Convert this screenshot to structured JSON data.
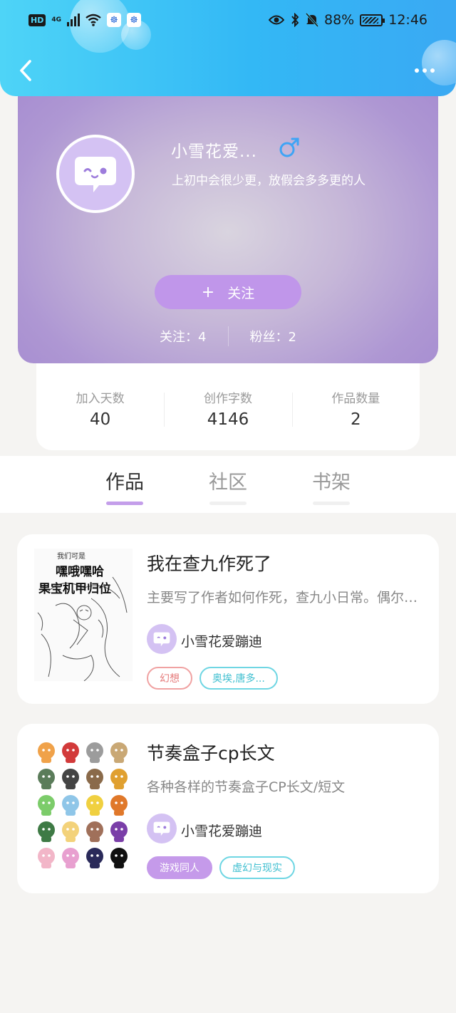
{
  "status_bar": {
    "network": "HD",
    "signal": "4G",
    "battery": "88%",
    "time": "12:46"
  },
  "profile": {
    "username": "小雪花爱...",
    "bio": "上初中会很少更，放假会多多更的人",
    "follow_button": "关注",
    "following": "关注：4",
    "followers": "粉丝：2"
  },
  "stats": [
    {
      "label": "加入天数",
      "value": "40"
    },
    {
      "label": "创作字数",
      "value": "4146"
    },
    {
      "label": "作品数量",
      "value": "2"
    }
  ],
  "tabs": [
    {
      "label": "作品",
      "active": true
    },
    {
      "label": "社区",
      "active": false
    },
    {
      "label": "书架",
      "active": false
    }
  ],
  "works": [
    {
      "title": "我在查九作死了",
      "desc": "主要写了作者如何作死，查九小日常。偶尔会加入一些别的内容",
      "author": "小雪花爱蹦迪",
      "tags": [
        {
          "text": "幻想",
          "style": "red"
        },
        {
          "text": "奥埃,唐多...",
          "style": "cyan"
        }
      ],
      "cover_text": [
        "我们可是",
        "嘿哦嘿哈",
        "果宝机甲归位"
      ]
    },
    {
      "title": "节奏盒子cp长文",
      "desc": "各种各样的节奏盒子CP长文/短文",
      "author": "小雪花爱蹦迪",
      "tags": [
        {
          "text": "游戏同人",
          "style": "purple"
        },
        {
          "text": "虚幻与现实",
          "style": "cyan"
        }
      ]
    }
  ],
  "colors": {
    "topbar": "#33b8f5",
    "accent": "#c49eea",
    "gender": "#3fa4f5"
  }
}
